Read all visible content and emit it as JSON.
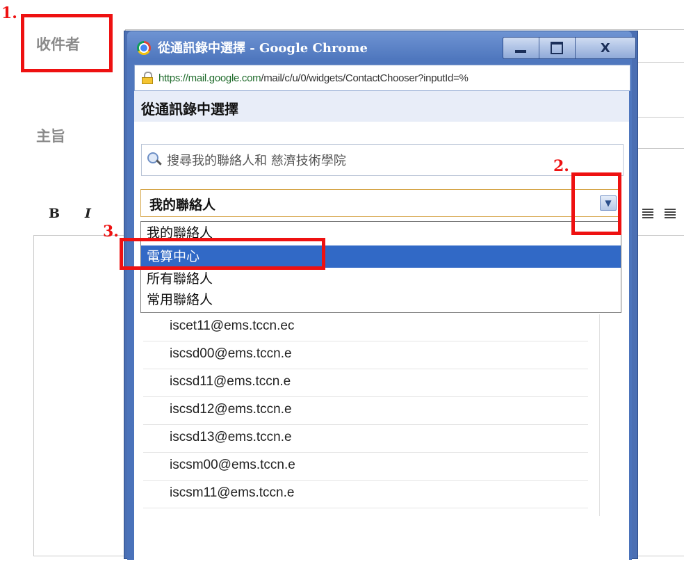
{
  "compose": {
    "to_label": "收件者",
    "subject_label": "主旨",
    "bold_label": "B",
    "italic_label": "I"
  },
  "popup": {
    "window_title": "從通訊錄中選擇 - Google Chrome",
    "close_label": "X",
    "url_scheme": "https://",
    "url_domain": "mail.google.com",
    "url_path": "/mail/c/u/0/widgets/ContactChooser?inputId=%",
    "heading": "從通訊錄中選擇",
    "search_placeholder": "搜尋我的聯絡人和 慈濟技術學院",
    "group_select": {
      "selected": "我的聯絡人",
      "options": [
        "我的聯絡人",
        "電算中心",
        "所有聯絡人",
        "常用聯絡人"
      ],
      "highlighted_index": 1
    },
    "contacts": [
      "iscet11@ems.tccn.ec",
      "iscsd00@ems.tccn.e",
      "iscsd11@ems.tccn.e",
      "iscsd12@ems.tccn.e",
      "iscsd13@ems.tccn.e",
      "iscsm00@ems.tccn.e",
      "iscsm11@ems.tccn.e"
    ]
  },
  "annotations": {
    "step1": "1.",
    "step2": "2.",
    "step3": "3.",
    "color": "#ee1111"
  }
}
